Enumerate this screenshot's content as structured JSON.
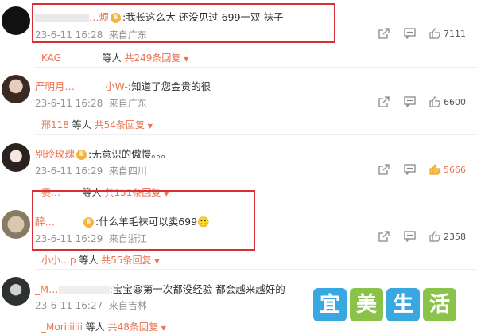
{
  "comments": [
    {
      "name": "…烦",
      "text": ":我长这么大 还没见过 699一双 袜子",
      "date": "23-6-11 16:28",
      "location": "来自广东",
      "reply_user": "KAG",
      "reply_mid": "等人",
      "reply_count": "共249条回复",
      "likes": "7111"
    },
    {
      "name": "严明月…",
      "name_tail": "小W-",
      "text": ":知道了您金贵的很",
      "date": "23-6-11 16:28",
      "location": "来自广东",
      "reply_user": "邢118",
      "reply_mid": "等人",
      "reply_count": "共54条回复",
      "likes": "6600"
    },
    {
      "name": "别玲玫瑰",
      "text": ":无意识的傲慢。。。",
      "date": "23-6-11 16:29",
      "location": "来自四川",
      "reply_user": "赛…",
      "reply_mid": "等人",
      "reply_count": "共151条回复",
      "likes": "5666"
    },
    {
      "name": "醉…",
      "text": ":什么羊毛袜可以卖699",
      "emoji": "🙂",
      "date": "23-6-11 16:29",
      "location": "来自浙江",
      "reply_user": "小小…p",
      "reply_mid": "等人",
      "reply_count": "共55条回复",
      "likes": "2358"
    },
    {
      "name": "_M…",
      "text": ":宝宝",
      "text2": "第一次都没经验 都会越来越好的",
      "date": "23-6-11 16:27",
      "location": "来自吉林",
      "reply_user": "_Moriiiiiii",
      "reply_mid": "等人",
      "reply_count": "共48条回复",
      "likes": ""
    }
  ],
  "watermark": [
    "宜",
    "美",
    "生",
    "活"
  ],
  "colors": {
    "accent": "#eb7350",
    "highlight_box": "#d8303a",
    "meta_gray": "#939393"
  },
  "icons": {
    "share": "share-icon",
    "comment": "comment-icon",
    "like": "thumbs-up-icon",
    "dropdown": "caret-down-icon"
  }
}
